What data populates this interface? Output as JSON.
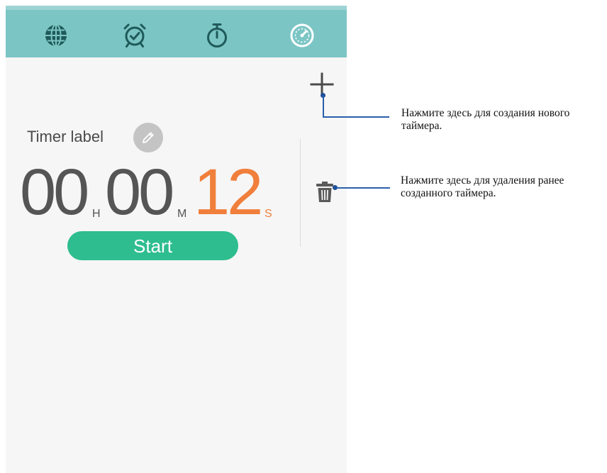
{
  "tabs": [
    {
      "name": "world-clock",
      "icon": "globe-icon"
    },
    {
      "name": "alarm",
      "icon": "alarm-clock-icon"
    },
    {
      "name": "stopwatch",
      "icon": "stopwatch-icon"
    },
    {
      "name": "timer",
      "icon": "timer-icon",
      "active": true
    }
  ],
  "timer": {
    "label": "Timer label",
    "hours": "00",
    "hours_unit": "H",
    "minutes": "00",
    "minutes_unit": "M",
    "seconds": "12",
    "seconds_unit": "S",
    "start_label": "Start"
  },
  "annotations": {
    "add_note_line1": "Нажмите здесь для создания нового",
    "add_note_line2": "таймера.",
    "delete_note_line1": "Нажмите здесь для удаления ранее",
    "delete_note_line2": "созданного таймера."
  },
  "colors": {
    "tab_bar": "#7cc5c5",
    "start_button": "#2ebd8e",
    "seconds_accent": "#f07f3c",
    "callout": "#2a5faa"
  }
}
